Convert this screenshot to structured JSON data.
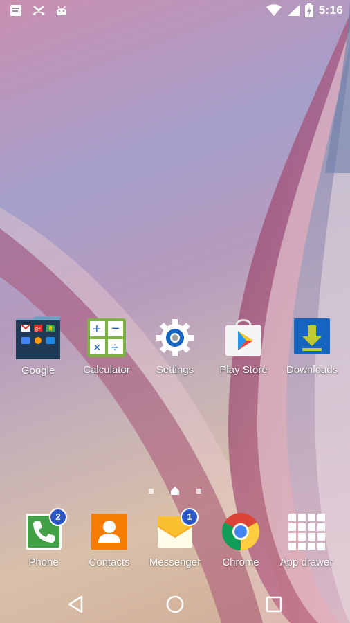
{
  "status_bar": {
    "time": "5:16",
    "left_icons": [
      "message-icon",
      "missed-call-icon",
      "android-icon"
    ],
    "right_icons": [
      "wifi-icon",
      "signal-icon",
      "battery-charging-icon"
    ]
  },
  "home_apps": [
    {
      "label": "Google",
      "icon": "google-folder-icon"
    },
    {
      "label": "Calculator",
      "icon": "calculator-icon"
    },
    {
      "label": "Settings",
      "icon": "settings-gear-icon"
    },
    {
      "label": "Play Store",
      "icon": "play-store-icon"
    },
    {
      "label": "Downloads",
      "icon": "download-icon"
    }
  ],
  "dock": [
    {
      "label": "Phone",
      "icon": "phone-icon",
      "badge": "2"
    },
    {
      "label": "Contacts",
      "icon": "contacts-icon"
    },
    {
      "label": "Messenger",
      "icon": "messenger-icon",
      "badge": "1"
    },
    {
      "label": "Chrome",
      "icon": "chrome-icon"
    },
    {
      "label": "App drawer",
      "icon": "app-drawer-icon"
    }
  ],
  "page_indicator": {
    "pages": 3,
    "current": "home"
  },
  "nav_bar": [
    "back-icon",
    "home-icon",
    "recents-icon"
  ],
  "colors": {
    "badge": "#2a56c6",
    "phone": "#43a047",
    "contacts": "#f57c00",
    "downloads": "#1565c0"
  }
}
